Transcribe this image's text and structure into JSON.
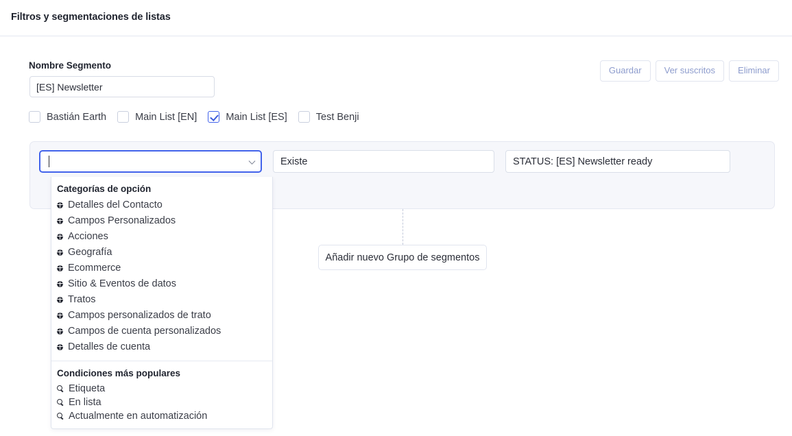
{
  "header": {
    "title": "Filtros y segmentaciones de listas"
  },
  "top_actions": [
    {
      "label": "Guardar",
      "name": "save-button"
    },
    {
      "label": "Ver suscritos",
      "name": "view-subscribers-button"
    },
    {
      "label": "Eliminar",
      "name": "delete-button"
    }
  ],
  "segment": {
    "label": "Nombre Segmento",
    "name_value": "[ES] Newsletter",
    "name_placeholder": ""
  },
  "lists": [
    {
      "label": "Bastián Earth",
      "checked": false
    },
    {
      "label": "Main List [EN]",
      "checked": false
    },
    {
      "label": "Main List [ES]",
      "checked": true
    },
    {
      "label": "Test Benji",
      "checked": false
    }
  ],
  "condition": {
    "field_value": "",
    "field_placeholder": "",
    "operator_value": "Existe",
    "value_value": "STATUS: [ES] Newsletter ready",
    "add_condition_label": "+"
  },
  "add_group_button": {
    "label": "Añadir nuevo Grupo de segmentos"
  },
  "dropdown": {
    "sections": [
      {
        "heading": "Categorías de opción",
        "icon": "globe-icon",
        "items": [
          "Detalles del Contacto",
          "Campos Personalizados",
          "Acciones",
          "Geografía",
          "Ecommerce",
          "Sitio & Eventos de datos",
          "Tratos",
          "Campos personalizados de trato",
          "Campos de cuenta personalizados",
          "Detalles de cuenta"
        ]
      },
      {
        "heading": "Condiciones más populares",
        "icon": "search-icon",
        "items": [
          "Etiqueta",
          "En lista",
          "Actualmente en automatización"
        ]
      }
    ]
  },
  "colors": {
    "accent": "#4263eb",
    "panel_bg": "#f6f7fb",
    "border": "#e1e5ef",
    "ghost_text": "#8d9ccd"
  }
}
